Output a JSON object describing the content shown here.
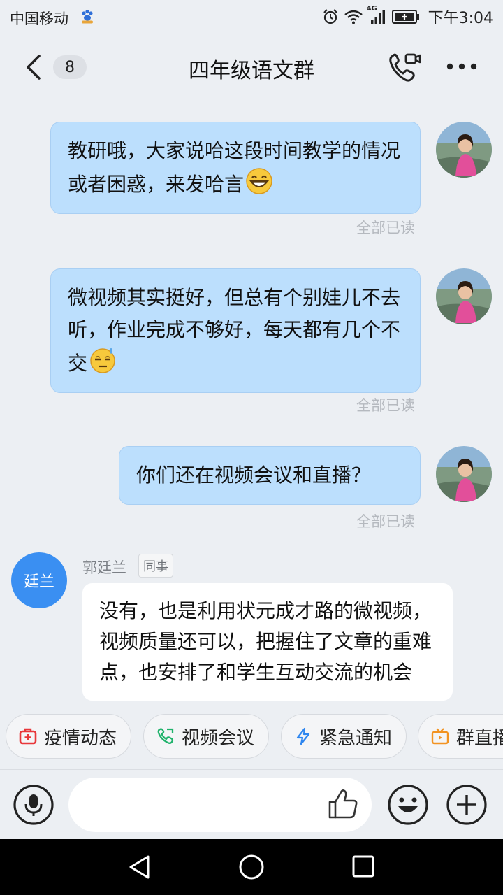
{
  "status_bar": {
    "carrier": "中国移动",
    "network": "4G",
    "time": "下午3:04"
  },
  "header": {
    "unread_count": "8",
    "title": "四年级语文群"
  },
  "messages": [
    {
      "direction": "outgoing",
      "text": "教研哦，大家说哈这段时间教学的情况或者困惑，来发哈言",
      "emoji": "grinning-face",
      "read_status": "全部已读"
    },
    {
      "direction": "outgoing",
      "text": "微视频其实挺好，但总有个别娃儿不去听，作业完成不够好，每天都有几个不交",
      "emoji": "sweat-face",
      "read_status": "全部已读"
    },
    {
      "direction": "outgoing",
      "text": "你们还在视频会议和直播？",
      "read_status": "全部已读"
    },
    {
      "direction": "incoming",
      "avatar_text": "廷兰",
      "sender": "郭廷兰",
      "tag": "同事",
      "text": "没有，也是利用状元成才路的微视频，视频质量还可以，把握住了文章的重难点，也安排了和学生互动交流的机会"
    }
  ],
  "quick_actions": [
    {
      "label": "疫情动态",
      "icon": "medical-kit-icon",
      "color": "#e8373a"
    },
    {
      "label": "视频会议",
      "icon": "phone-icon",
      "color": "#1fb26b"
    },
    {
      "label": "紧急通知",
      "icon": "lightning-icon",
      "color": "#2e86ef"
    },
    {
      "label": "群直播",
      "icon": "tv-icon",
      "color": "#f29322"
    }
  ],
  "input": {
    "placeholder": ""
  },
  "colors": {
    "outgoing_bubble": "#bcdffd",
    "incoming_bubble": "#ffffff",
    "text_avatar": "#3a8ff2",
    "background": "#eceff3"
  }
}
